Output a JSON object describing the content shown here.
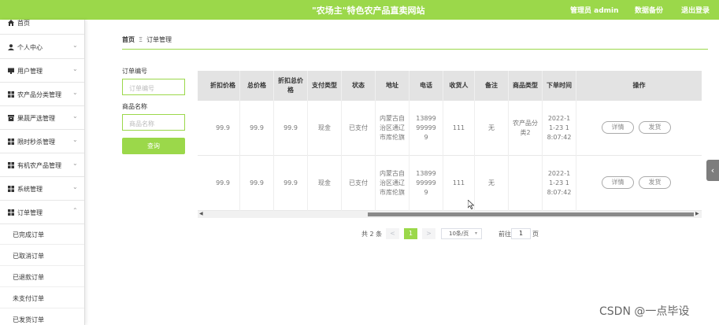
{
  "header": {
    "title": "\"农场主\"特色农产品直卖网站",
    "admin_label": "管理员 admin",
    "backup_label": "数据备份",
    "logout_label": "退出登录",
    "bg_color": "#9bd84a"
  },
  "sidebar": {
    "items": [
      {
        "label": "首页",
        "icon": "home-icon"
      },
      {
        "label": "个人中心",
        "icon": "user-icon"
      },
      {
        "label": "用户管理",
        "icon": "monitor-icon"
      },
      {
        "label": "农产品分类管理",
        "icon": "grid-icon"
      },
      {
        "label": "果蔬严选管理",
        "icon": "box-icon"
      },
      {
        "label": "限时秒杀管理",
        "icon": "grid-icon"
      },
      {
        "label": "有机农产品管理",
        "icon": "grid-icon"
      },
      {
        "label": "系统管理",
        "icon": "grid-icon"
      },
      {
        "label": "订单管理",
        "icon": "grid-icon"
      }
    ],
    "sub_items": [
      {
        "label": "已完成订单"
      },
      {
        "label": "已取消订单"
      },
      {
        "label": "已退款订单"
      },
      {
        "label": "未支付订单"
      },
      {
        "label": "已发货订单"
      }
    ]
  },
  "breadcrumb": {
    "home": "首页",
    "separator": "Ξ",
    "current": "订单管理"
  },
  "search": {
    "order_no_label": "订单编号",
    "order_no_placeholder": "订单编号",
    "product_name_label": "商品名称",
    "product_name_placeholder": "商品名称",
    "query_label": "查询"
  },
  "table": {
    "headers": [
      "折扣价格",
      "总价格",
      "折扣总价格",
      "支付类型",
      "状态",
      "地址",
      "电话",
      "收货人",
      "备注",
      "商品类型",
      "下单时间",
      "操作"
    ],
    "rows": [
      {
        "discount_price": "99.9",
        "total_price": "99.9",
        "discount_total": "99.9",
        "pay_type": "现金",
        "status": "已支付",
        "address": "内蒙古自治区通辽市库伦旗",
        "phone": "13899999999",
        "receiver": "111",
        "remark": "无",
        "product_type": "农产品分类2",
        "order_time": "2022-11-23 18:07:42",
        "detail_label": "详情",
        "ship_label": "发货"
      },
      {
        "discount_price": "99.9",
        "total_price": "99.9",
        "discount_total": "99.9",
        "pay_type": "现金",
        "status": "已支付",
        "address": "内蒙古自治区通辽市库伦旗",
        "phone": "13899999999",
        "receiver": "111",
        "remark": "无",
        "product_type": "",
        "order_time": "2022-11-23 18:07:42",
        "detail_label": "详情",
        "ship_label": "发货"
      }
    ]
  },
  "pagination": {
    "total_text": "共 2 条",
    "prev": "<",
    "current_page": "1",
    "next": ">",
    "page_size": "10条/页",
    "goto_label": "前往",
    "goto_value": "1",
    "page_suffix": "页"
  },
  "side_tab_icon": "chevron-left-icon",
  "watermark": "CSDN @一点毕设"
}
